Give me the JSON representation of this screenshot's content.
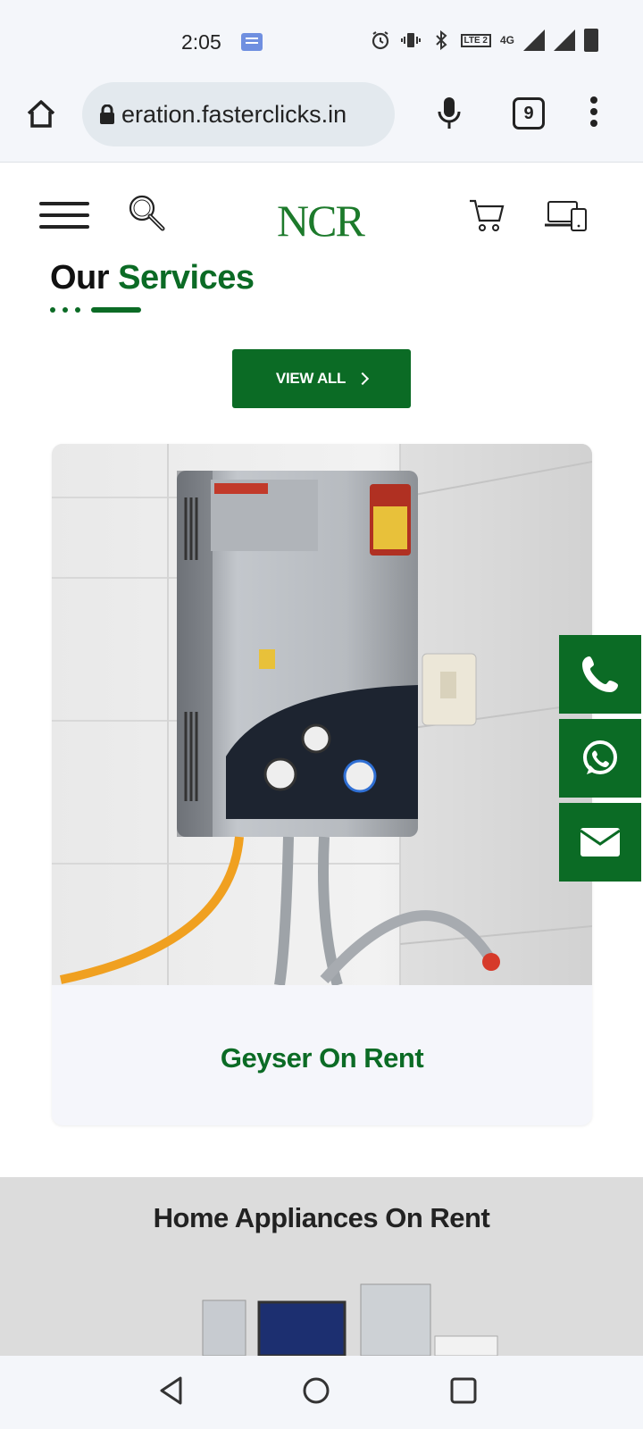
{
  "status_bar": {
    "time": "2:05",
    "lte_label": "LTE 2",
    "network": "4G"
  },
  "browser": {
    "url": "eration.fasterclicks.in",
    "tab_count": "9"
  },
  "site": {
    "logo": "NCR",
    "section_title_plain": "Our",
    "section_title_accent": "Services",
    "view_all_label": "VIEW ALL",
    "card_title": "Geyser On Rent",
    "banner_title": "Home Appliances On Rent"
  },
  "colors": {
    "brand_green": "#0b6b25",
    "logo_green": "#1c7a2b",
    "status_bar_bg": "#f4f6fa"
  }
}
